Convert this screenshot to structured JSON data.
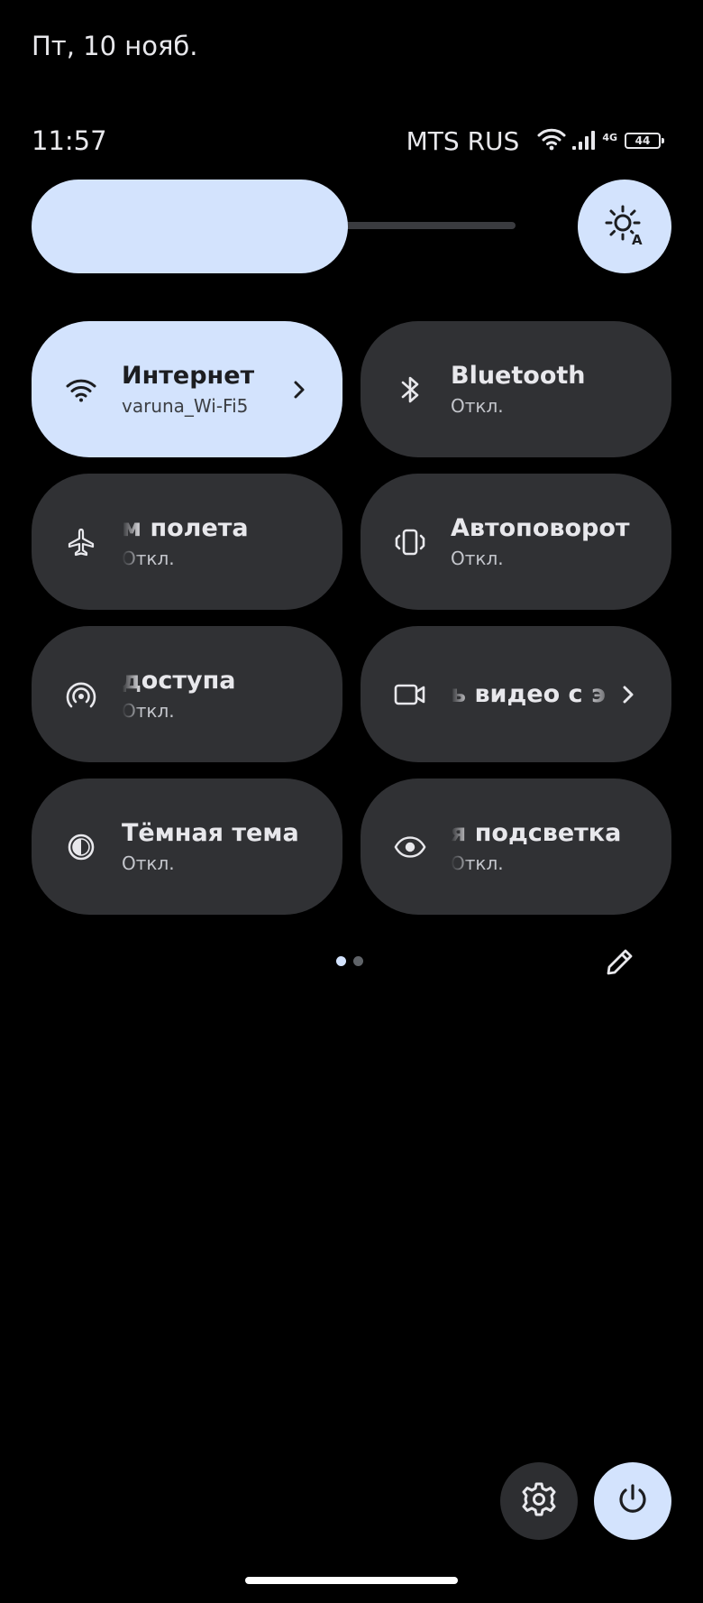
{
  "header": {
    "date": "Пт, 10 нояб."
  },
  "status_bar": {
    "time": "11:57",
    "carrier": "MTS RUS",
    "network_type": "4G",
    "battery_level": "44",
    "icons": [
      "wifi-icon",
      "signal-icon",
      "battery-icon"
    ]
  },
  "brightness": {
    "level_percent": 57,
    "auto_icon": "auto-brightness-icon"
  },
  "tiles": [
    {
      "title": "Интернет",
      "subtitle": "varuna_Wi-Fi5",
      "icon": "wifi-icon",
      "active": true,
      "has_chevron": true
    },
    {
      "title": "Bluetooth",
      "subtitle": "Откл.",
      "icon": "bluetooth-icon",
      "active": false
    },
    {
      "title": "м полета",
      "subtitle": "Откл.",
      "icon": "airplane-icon",
      "active": false
    },
    {
      "title": "Автоповорот",
      "subtitle": "Откл.",
      "icon": "auto-rotate-icon",
      "active": false
    },
    {
      "title": "доступа",
      "subtitle": "Откл.",
      "icon": "hotspot-icon",
      "active": false
    },
    {
      "title": "ь видео с э",
      "subtitle": "",
      "icon": "screen-record-icon",
      "active": false,
      "has_chevron": true
    },
    {
      "title": "Тёмная тема",
      "subtitle": "Откл.",
      "icon": "dark-theme-icon",
      "active": false
    },
    {
      "title": "я подсветка",
      "subtitle": "Откл.",
      "icon": "eye-comfort-icon",
      "active": false
    }
  ],
  "pager": {
    "total": 2,
    "current": 1
  },
  "colors": {
    "accent": "#d3e3fd",
    "tile_bg": "#303134",
    "background": "#000000"
  }
}
